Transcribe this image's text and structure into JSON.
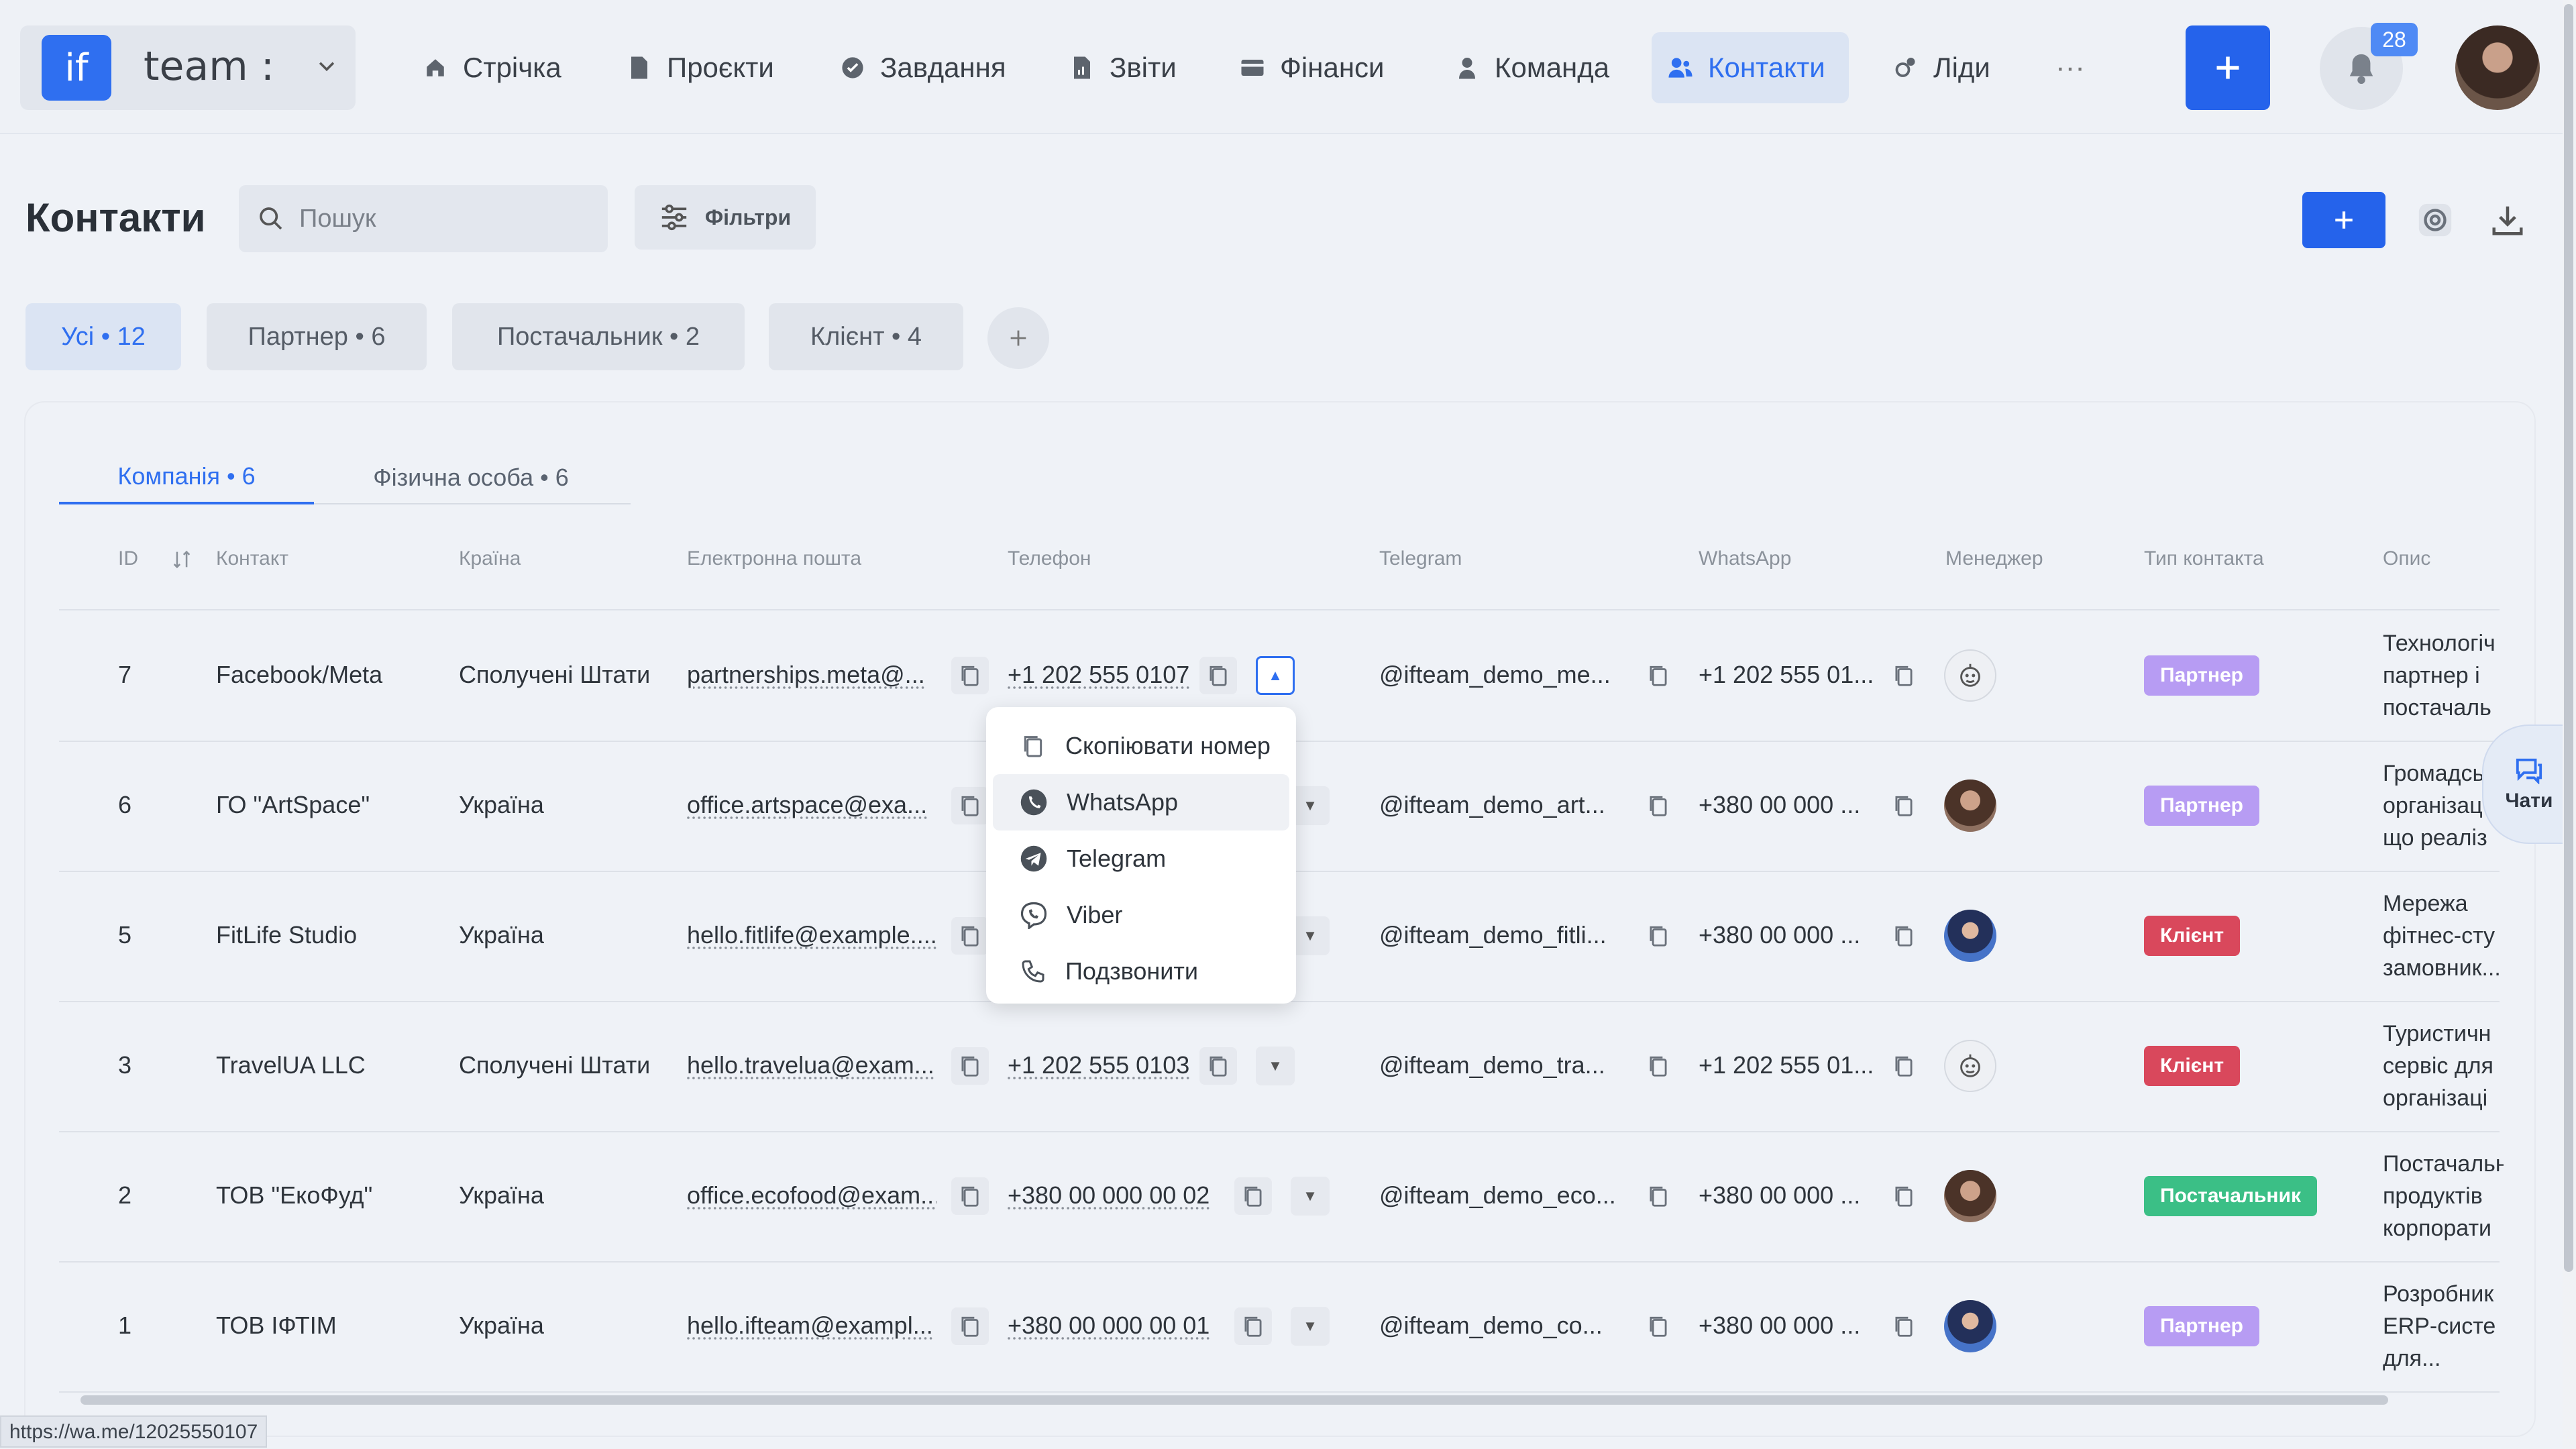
{
  "app": {
    "logo_mark": "if",
    "logo_text": "team :",
    "notifications": "28"
  },
  "nav": {
    "items": [
      {
        "label": "Стрічка",
        "icon": "home-icon"
      },
      {
        "label": "Проєкти",
        "icon": "file-icon"
      },
      {
        "label": "Завдання",
        "icon": "check-circle-icon"
      },
      {
        "label": "Звіти",
        "icon": "report-icon"
      },
      {
        "label": "Фінанси",
        "icon": "wallet-icon"
      },
      {
        "label": "Команда",
        "icon": "person-icon"
      },
      {
        "label": "Контакти",
        "icon": "contacts-icon",
        "active": true
      },
      {
        "label": "Ліди",
        "icon": "leads-icon"
      }
    ],
    "more": "···"
  },
  "page": {
    "title": "Контакти",
    "search_placeholder": "Пошук",
    "filters_label": "Фільтри"
  },
  "segments": [
    "Усі • 12",
    "Партнер • 6",
    "Постачальник • 2",
    "Клієнт • 4"
  ],
  "tabs": [
    "Компанія • 6",
    "Фізична особа • 6"
  ],
  "columns": [
    "ID",
    "Контакт",
    "Країна",
    "Електронна пошта",
    "Телефон",
    "Telegram",
    "WhatsApp",
    "Менеджер",
    "Тип контакта",
    "Опис"
  ],
  "rows": [
    {
      "id": "7",
      "contact": "Facebook/Meta",
      "country": "Сполучені Штати",
      "email": "partnerships.meta@...",
      "phone": "+1 202 555 0107",
      "telegram": "@ifteam_demo_me...",
      "whatsapp": "+1 202 555 01...",
      "type": "Партнер",
      "desc1": "Технологіч",
      "desc2": "партнер і",
      "desc3": "постачаль"
    },
    {
      "id": "6",
      "contact": "ГО \"ArtSpace\"",
      "country": "Україна",
      "email": "office.artspace@exa...",
      "phone": "",
      "telegram": "@ifteam_demo_art...",
      "whatsapp": "+380 00 000 ...",
      "type": "Партнер",
      "desc1": "Громадськ",
      "desc2": "організац",
      "desc3": "що реаліз"
    },
    {
      "id": "5",
      "contact": "FitLife Studio",
      "country": "Україна",
      "email": "hello.fitlife@example....",
      "phone": "",
      "telegram": "@ifteam_demo_fitli...",
      "whatsapp": "+380 00 000 ...",
      "type": "Клієнт",
      "desc1": "Мережа",
      "desc2": "фітнес-сту",
      "desc3": "замовник..."
    },
    {
      "id": "3",
      "contact": "TravelUA LLC",
      "country": "Сполучені Штати",
      "email": "hello.travelua@exam...",
      "phone": "+1 202 555 0103",
      "telegram": "@ifteam_demo_tra...",
      "whatsapp": "+1 202 555 01...",
      "type": "Клієнт",
      "desc1": "Туристичн",
      "desc2": "сервіс для",
      "desc3": "організаці"
    },
    {
      "id": "2",
      "contact": "ТОВ \"ЕкоФуд\"",
      "country": "Україна",
      "email": "office.ecofood@exam...",
      "phone": "+380 00 000 00 02",
      "telegram": "@ifteam_demo_eco...",
      "whatsapp": "+380 00 000 ...",
      "type": "Постачальник",
      "desc1": "Постачальн",
      "desc2": "продуктів",
      "desc3": "корпорати"
    },
    {
      "id": "1",
      "contact": "ТОВ ІФТІМ",
      "country": "Україна",
      "email": "hello.ifteam@exampl...",
      "phone": "+380 00 000 00 01",
      "telegram": "@ifteam_demo_co...",
      "whatsapp": "+380 00 000 ...",
      "type": "Партнер",
      "desc1": "Розробник",
      "desc2": "ERP-систе",
      "desc3": "для..."
    }
  ],
  "menu": [
    "Скопіювати номер",
    "WhatsApp",
    "Telegram",
    "Viber",
    "Подзвонити"
  ],
  "chats_label": "Чати",
  "status_url": "https://wa.me/12025550107",
  "colors": {
    "accent": "#2563eb",
    "partner": "#b79cf3",
    "client": "#d9485c",
    "supplier": "#3bbf86"
  }
}
